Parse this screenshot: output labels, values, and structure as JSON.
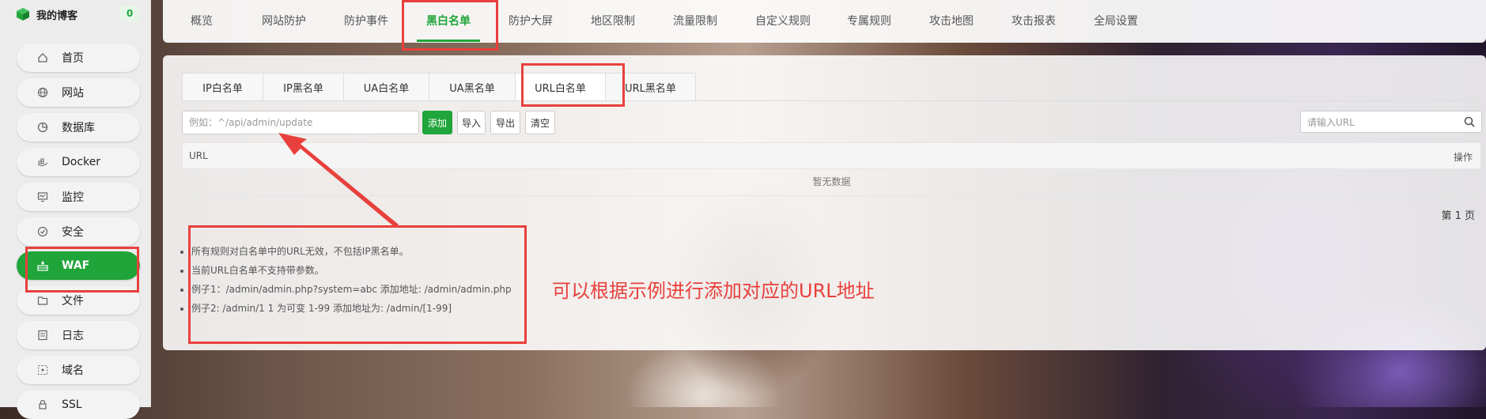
{
  "brand": {
    "title": "我的博客",
    "badge": "0"
  },
  "sidebar": {
    "items": [
      {
        "label": "首页",
        "icon": "home-icon"
      },
      {
        "label": "网站",
        "icon": "globe-icon"
      },
      {
        "label": "数据库",
        "icon": "database-icon"
      },
      {
        "label": "Docker",
        "icon": "docker-icon"
      },
      {
        "label": "监控",
        "icon": "monitor-icon"
      },
      {
        "label": "安全",
        "icon": "shield-icon"
      },
      {
        "label": "WAF",
        "icon": "firewall-icon",
        "active": true
      },
      {
        "label": "文件",
        "icon": "folder-icon"
      },
      {
        "label": "日志",
        "icon": "log-icon"
      },
      {
        "label": "域名",
        "icon": "domain-icon"
      },
      {
        "label": "SSL",
        "icon": "ssl-icon"
      }
    ]
  },
  "top_tabs": [
    "概览",
    "网站防护",
    "防护事件",
    "黑白名单",
    "防护大屏",
    "地区限制",
    "流量限制",
    "自定义规则",
    "专属规则",
    "攻击地图",
    "攻击报表",
    "全局设置"
  ],
  "top_tabs_active": "黑白名单",
  "sub_tabs": [
    "IP白名单",
    "IP黑名单",
    "UA白名单",
    "UA黑名单",
    "URL白名单",
    "URL黑名单"
  ],
  "sub_tabs_active": "URL白名单",
  "toolbar": {
    "input_placeholder": "例如：^/api/admin/update",
    "add_label": "添加",
    "import_label": "导入",
    "export_label": "导出",
    "clear_label": "清空",
    "search_placeholder": "请输入URL"
  },
  "table": {
    "columns": [
      "URL",
      "操作"
    ],
    "empty_text": "暂无数据"
  },
  "pager": {
    "text": "第 1 页"
  },
  "tips": [
    "所有规则对白名单中的URL无效，不包括IP黑名单。",
    "当前URL白名单不支持带参数。",
    "例子1：/admin/admin.php?system=abc 添加地址: /admin/admin.php",
    "例子2: /admin/1 1 为可变 1-99 添加地址为: /admin/[1-99]"
  ],
  "annotation": {
    "text": "可以根据示例进行添加对应的URL地址",
    "color": "#e8403c"
  },
  "colors": {
    "accent": "#20a53a",
    "annotation": "#e8403c"
  }
}
